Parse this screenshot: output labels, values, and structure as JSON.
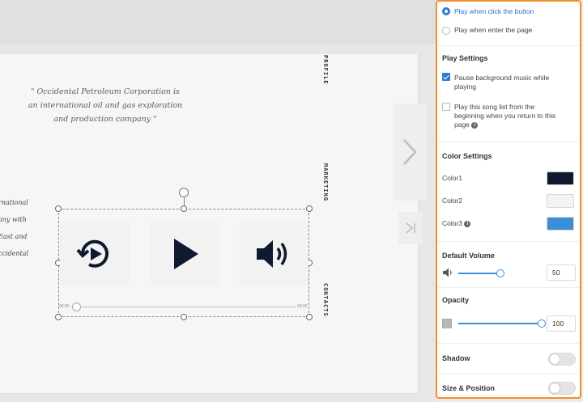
{
  "canvas": {
    "quote": [
      "\" Occidental Petroleum Corporation is",
      "an international oil and gas exploration",
      "and production company \""
    ],
    "left_text": [
      "rnational",
      "any with",
      "East and",
      "ccidental"
    ],
    "vertical_labels": [
      "PROFILE",
      "MARKETING",
      "CONTACTS"
    ]
  },
  "player": {
    "time_start": "00:00",
    "time_end": "00:00",
    "progress": 0
  },
  "panel": {
    "play_options": [
      {
        "label": "Play when click the button",
        "selected": true
      },
      {
        "label": "Play when enter the page",
        "selected": false
      }
    ],
    "play_settings": {
      "heading": "Play Settings",
      "pause_bg": {
        "label_line1": "Pause background music while",
        "label_line2": "playing",
        "checked": true
      },
      "replay": {
        "label_line1": "Play this song list from the",
        "label_line2": "beginning when you return to this",
        "label_line3": "page",
        "checked": false
      }
    },
    "color_settings": {
      "heading": "Color Settings",
      "colors": [
        {
          "label": "Color1",
          "value": "#0f1a2e"
        },
        {
          "label": "Color2",
          "value": "#f4f4f4"
        },
        {
          "label": "Color3",
          "value": "#3b8fd4"
        }
      ]
    },
    "default_volume": {
      "heading": "Default Volume",
      "value": "50"
    },
    "opacity": {
      "heading": "Opacity",
      "value": "100"
    },
    "shadow": {
      "heading": "Shadow",
      "on": false
    },
    "size_position": {
      "heading": "Size & Position",
      "on": false
    },
    "accent_color": "#2b7bd1",
    "highlight_border": "#f0902e"
  }
}
